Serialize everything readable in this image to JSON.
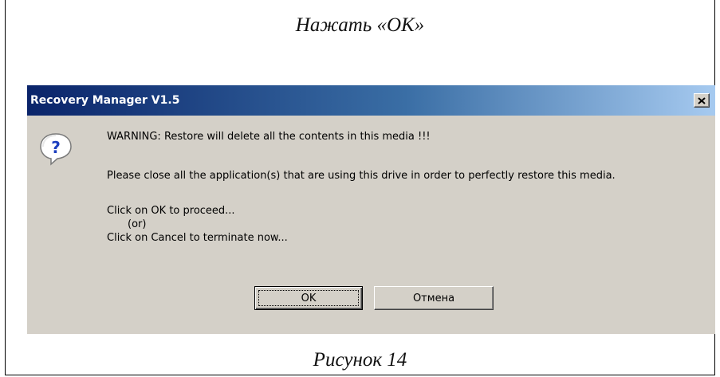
{
  "page": {
    "caption_top": "Нажать «OK»",
    "caption_bottom": "Рисунок 14"
  },
  "dialog": {
    "title": "Recovery Manager V1.5",
    "icon": "question-icon",
    "close_icon": "close-icon",
    "line1": "WARNING: Restore will delete all the contents in this media !!!",
    "line2": "Please close all the application(s) that are using this drive in order to perfectly restore this media.",
    "line3": "Click on OK to proceed...",
    "line4": "(or)",
    "line5": "Click on Cancel to terminate now...",
    "ok_label": "OK",
    "cancel_label": "Отмена"
  },
  "colors": {
    "dialog_bg": "#d4d0c8",
    "titlebar_start": "#0a246a",
    "titlebar_end": "#a6caf0"
  }
}
